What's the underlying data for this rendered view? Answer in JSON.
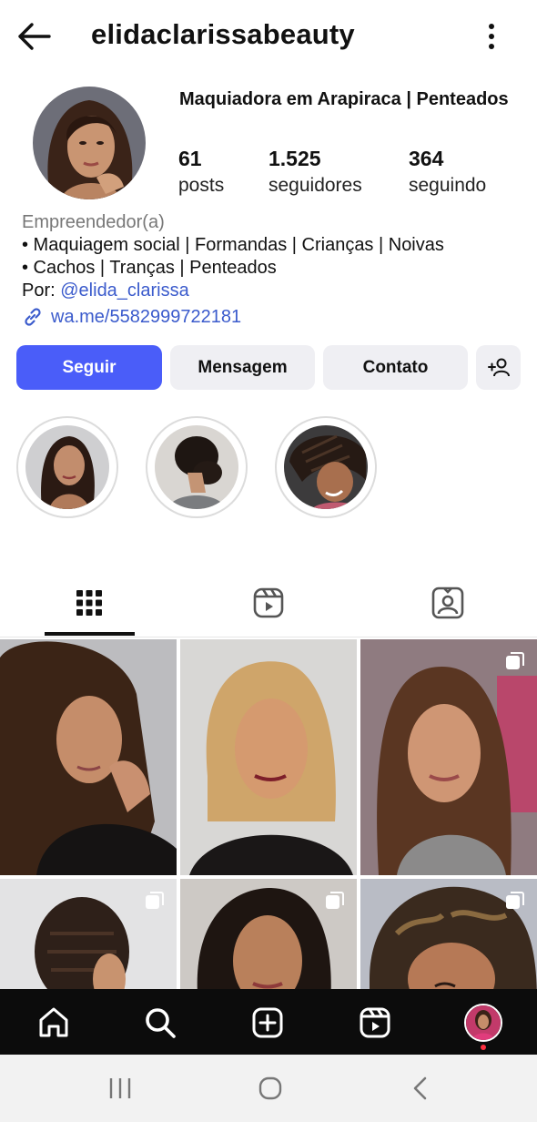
{
  "header": {
    "username": "elidaclarissabeauty",
    "back_icon": "arrow-left-icon",
    "more_icon": "more-vertical-icon"
  },
  "profile": {
    "name": "Maquiadora em Arapiraca | Penteados",
    "stats": [
      {
        "value": "61",
        "label": "posts"
      },
      {
        "value": "1.525",
        "label": "seguidores"
      },
      {
        "value": "364",
        "label": "seguindo"
      }
    ],
    "category": "Empreendedor(a)",
    "bio_lines": [
      "• Maquiagem social | Formandas | Crianças | Noivas",
      "• Cachos | Tranças | Penteados"
    ],
    "by_prefix": "Por: ",
    "mention": "@elida_clarissa",
    "link": "wa.me/5582999722181"
  },
  "actions": {
    "follow": "Seguir",
    "message": "Mensagem",
    "contact": "Contato",
    "add_icon": "add-person-icon"
  },
  "highlights": [
    {
      "icon": "highlight-portrait"
    },
    {
      "icon": "highlight-hairstyle"
    },
    {
      "icon": "highlight-braids"
    }
  ],
  "tabs": [
    {
      "icon": "grid-icon",
      "active": true
    },
    {
      "icon": "reels-icon",
      "active": false
    },
    {
      "icon": "tagged-icon",
      "active": false
    }
  ],
  "bottom_nav": [
    {
      "icon": "home-icon"
    },
    {
      "icon": "search-icon"
    },
    {
      "icon": "create-icon"
    },
    {
      "icon": "reels-icon"
    },
    {
      "icon": "profile-avatar"
    }
  ],
  "system_nav": [
    {
      "icon": "recents-icon"
    },
    {
      "icon": "home-circle-icon"
    },
    {
      "icon": "back-chevron-icon"
    }
  ],
  "colors": {
    "accent": "#4a5df9",
    "link": "#3b5bcc",
    "secondary_button": "#efeff3",
    "bottom_bar": "#0c0c0c"
  }
}
